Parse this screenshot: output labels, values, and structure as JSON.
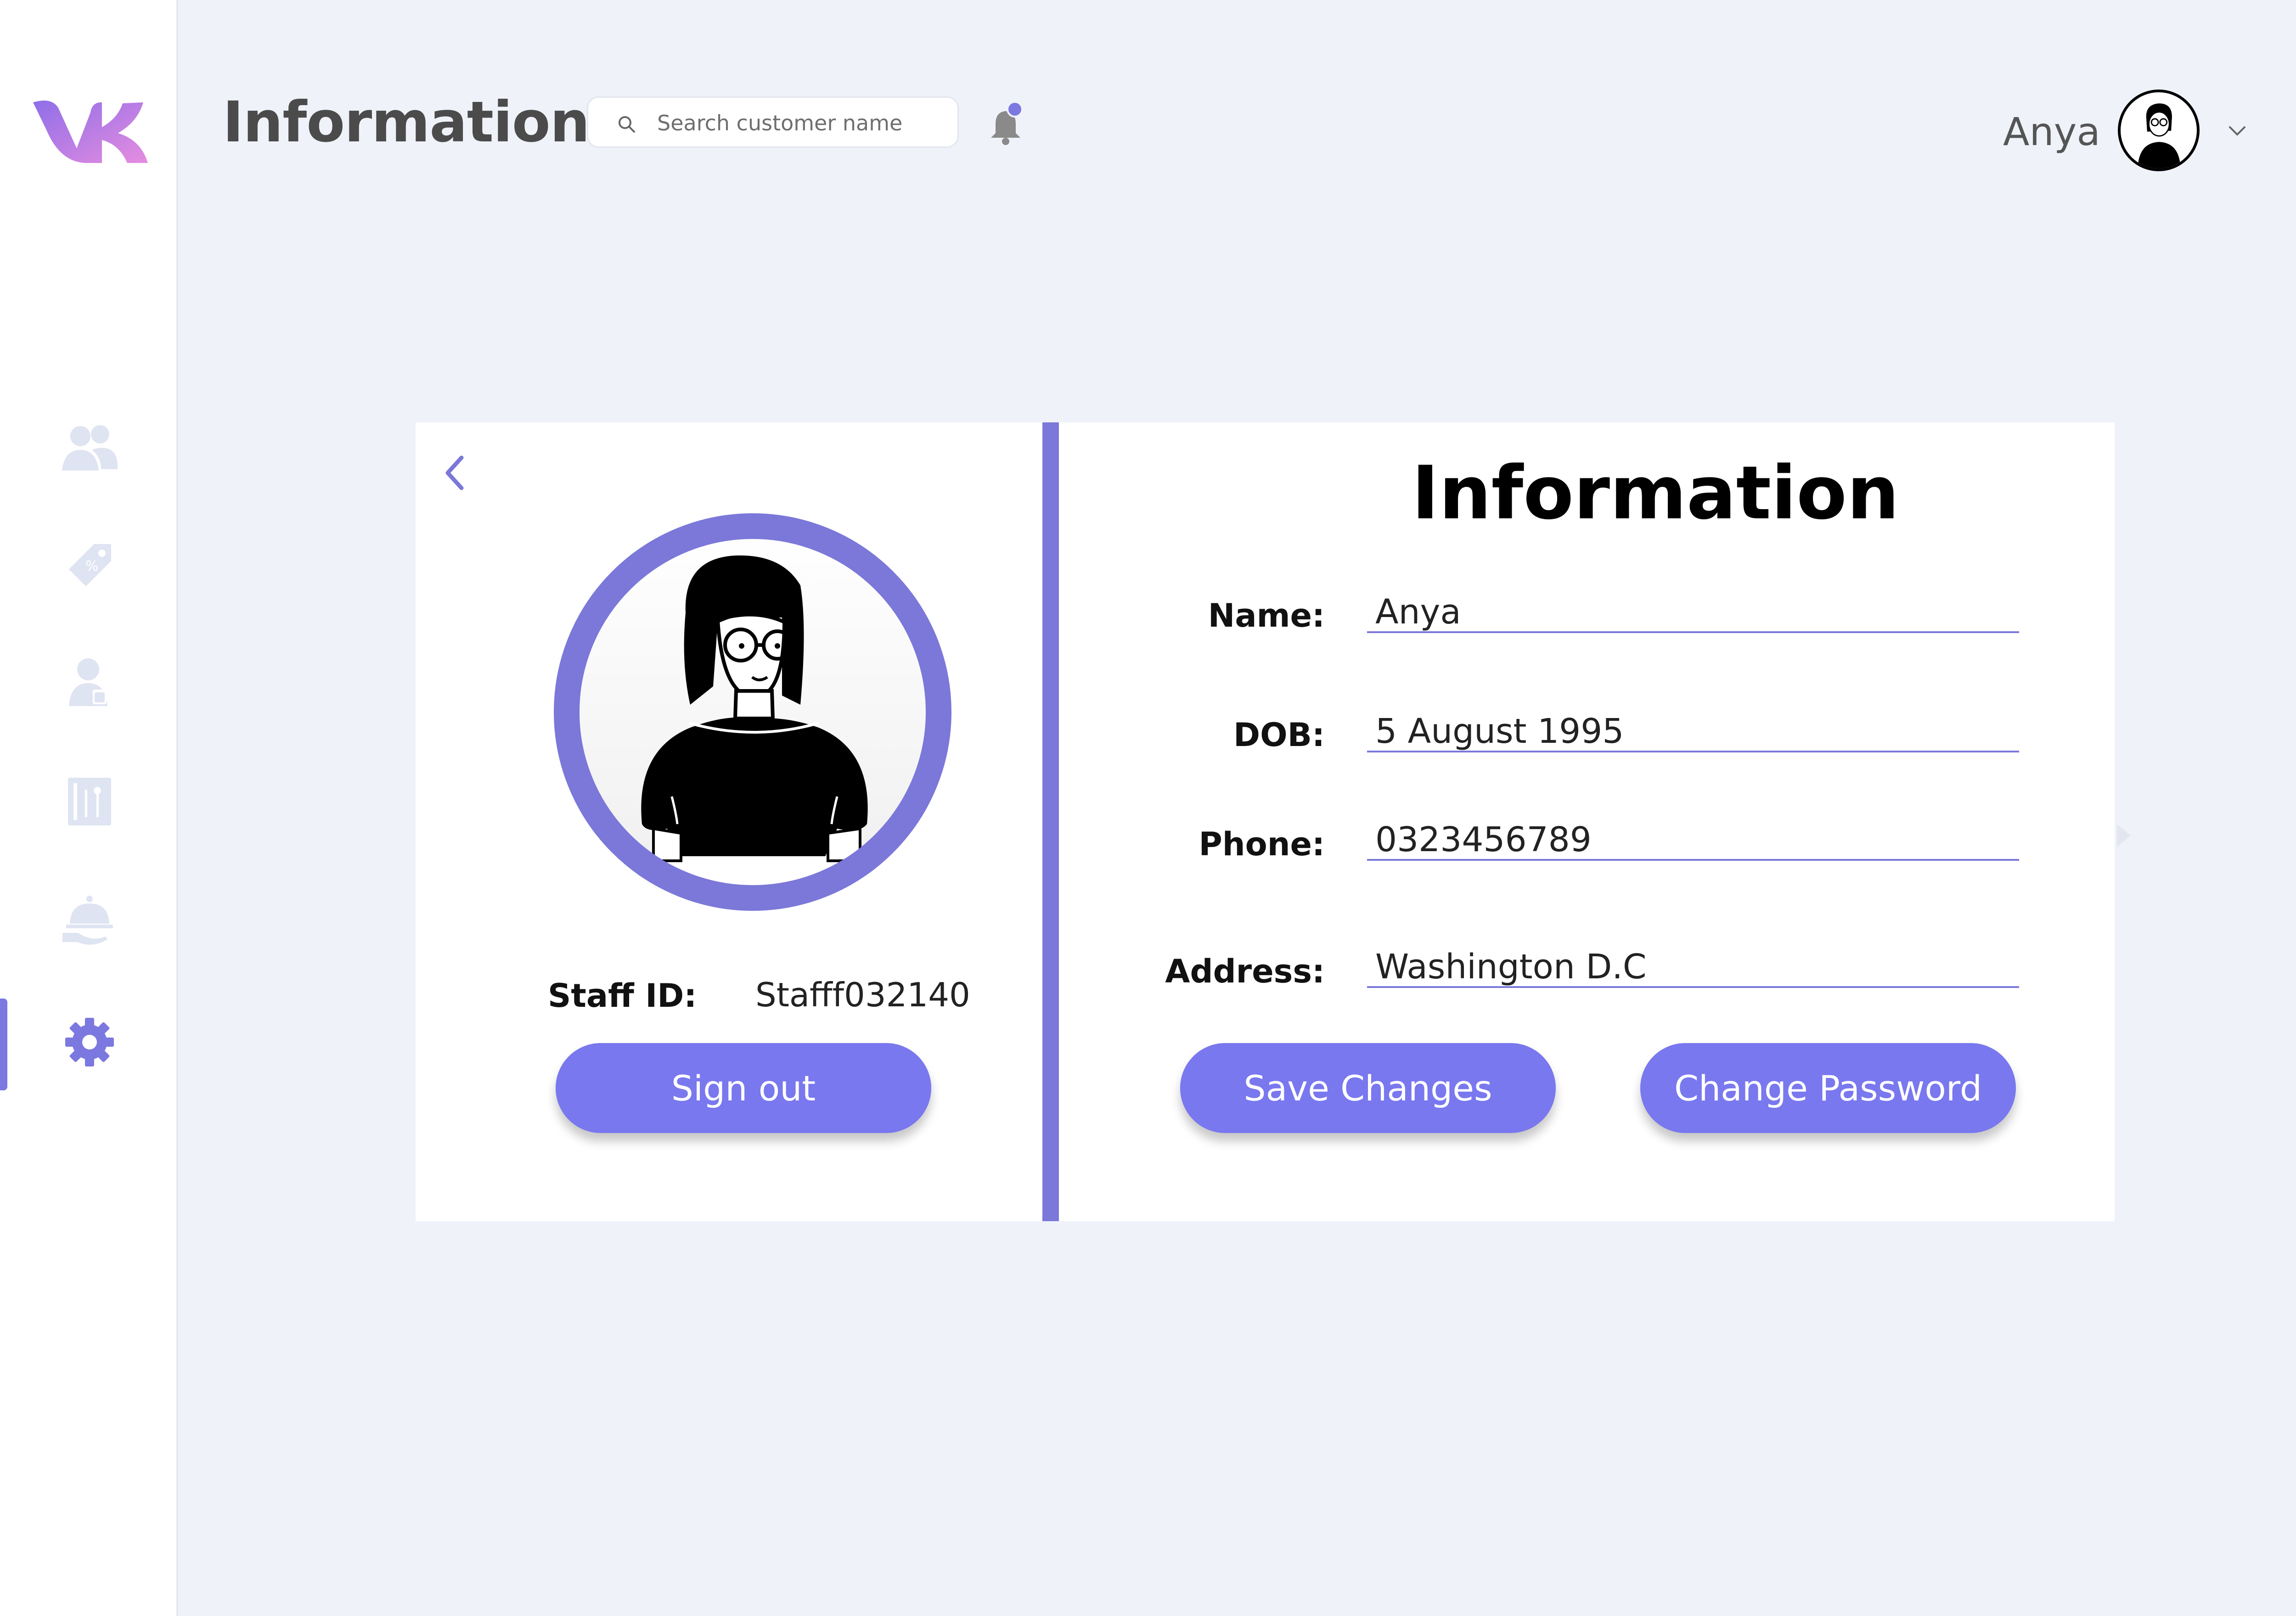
{
  "header": {
    "title": "Information",
    "search_placeholder": "Search customer name",
    "user_name": "Anya"
  },
  "sidebar": {
    "logo": "vk-logo",
    "items": [
      {
        "icon": "users-icon",
        "active": false
      },
      {
        "icon": "tag-icon",
        "active": false
      },
      {
        "icon": "staff-icon",
        "active": false
      },
      {
        "icon": "menu-board-icon",
        "active": false
      },
      {
        "icon": "room-service-icon",
        "active": false
      },
      {
        "icon": "settings-icon",
        "active": true
      }
    ]
  },
  "profile": {
    "staff_id_label": "Staff ID:",
    "staff_id_value": "Stafff032140",
    "sign_out_label": "Sign out"
  },
  "info": {
    "heading": "Information",
    "fields": [
      {
        "label": "Name:",
        "value": "Anya"
      },
      {
        "label": "DOB:",
        "value": "5 August 1995"
      },
      {
        "label": "Phone:",
        "value": "0323456789"
      },
      {
        "label": "Address:",
        "value": "Washington D.C"
      }
    ],
    "save_label": "Save Changes",
    "change_password_label": "Change Password"
  },
  "colors": {
    "accent": "#7978ef",
    "divider": "#7b78d9",
    "background": "#eff2f9",
    "sidebar_icon": "#dfe4f2",
    "notification_dot": "#7b78e0"
  }
}
